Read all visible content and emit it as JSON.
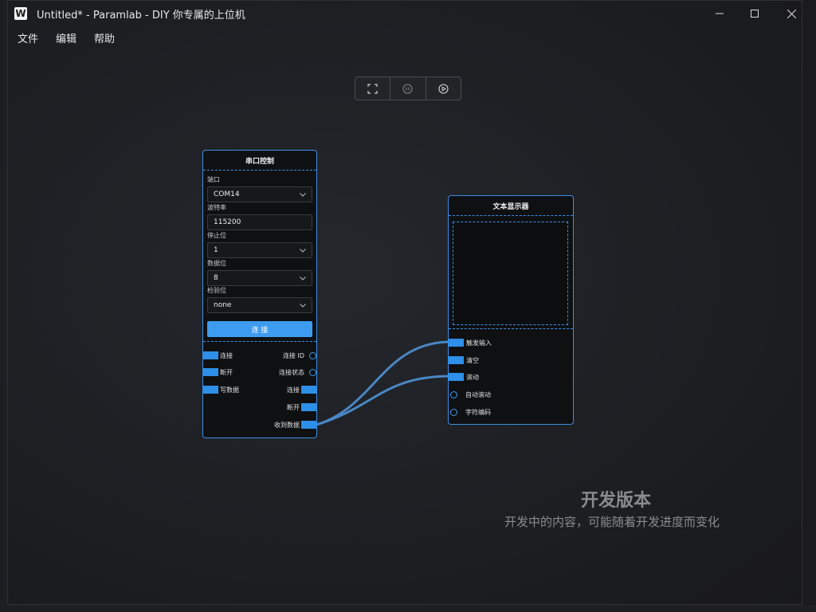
{
  "window": {
    "icon_letter": "W",
    "title": "Untitled* - Paramlab - DIY 你专属的上位机"
  },
  "menu": [
    "文件",
    "编辑",
    "帮助"
  ],
  "toolbar": {
    "buttons": [
      "fullscreen-icon",
      "pause-icon",
      "play-icon"
    ]
  },
  "serial_node": {
    "title": "串口控制",
    "port_label": "端口",
    "port_value": "COM14",
    "baud_label": "波特率",
    "baud_value": "115200",
    "stop_label": "停止位",
    "stop_value": "1",
    "data_label": "数据位",
    "data_value": "8",
    "parity_label": "检验位",
    "parity_value": "none",
    "connect_button": "连 接",
    "inputs": [
      "连接",
      "断开",
      "写数据"
    ],
    "outputs": [
      "连接 ID",
      "连接状态",
      "连接",
      "断开",
      "收到数据"
    ]
  },
  "text_node": {
    "title": "文本显示器",
    "inputs": [
      "触发输入",
      "清空",
      "滚动",
      "自动滚动",
      "字符编码"
    ]
  },
  "watermark": {
    "title": "开发版本",
    "subtitle": "开发中的内容，可能随着开发进度而变化"
  },
  "colors": {
    "accent": "#3d8ee6",
    "button": "#3d9cf0",
    "wire": "#4a86c4"
  }
}
